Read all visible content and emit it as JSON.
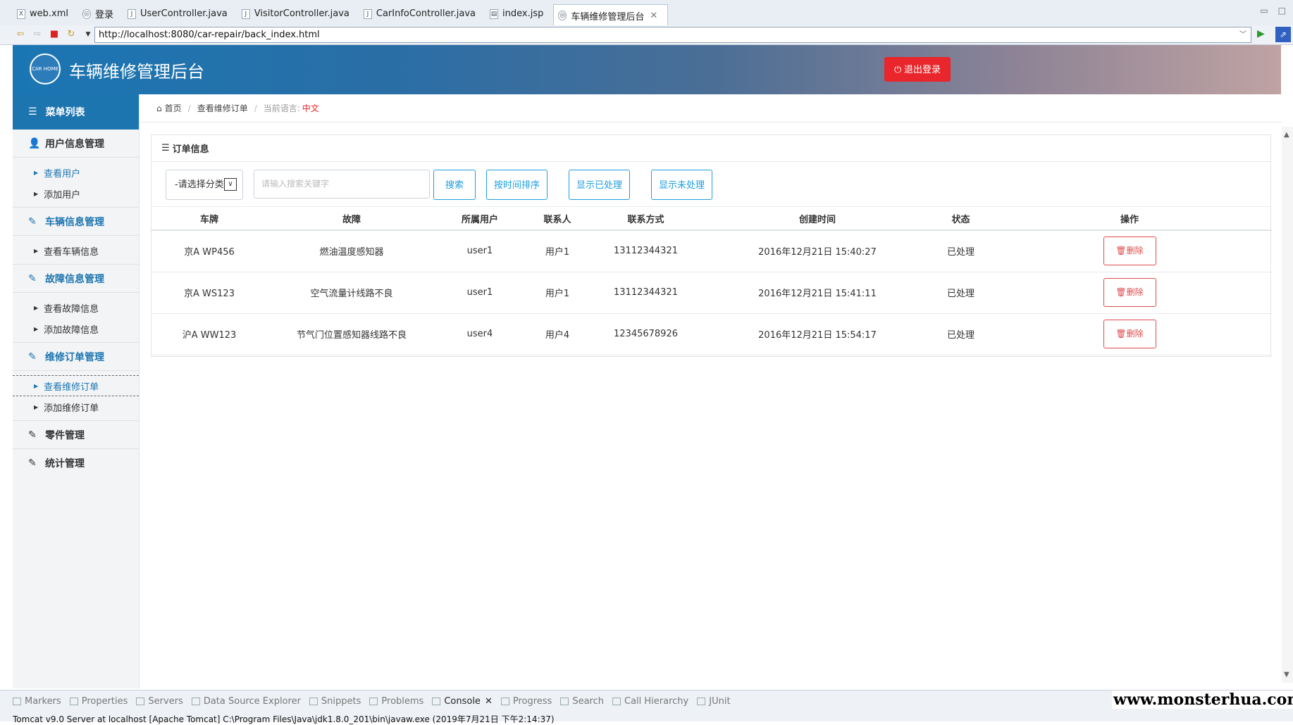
{
  "ide_tabs": [
    {
      "label": "web.xml",
      "icon": "xml-file-icon"
    },
    {
      "label": "登录",
      "icon": "globe-icon"
    },
    {
      "label": "UserController.java",
      "icon": "java-file-icon"
    },
    {
      "label": "VisitorController.java",
      "icon": "java-file-icon"
    },
    {
      "label": "CarInfoController.java",
      "icon": "java-file-icon"
    },
    {
      "label": "index.jsp",
      "icon": "jsp-file-icon"
    },
    {
      "label": "车辆维修管理后台",
      "icon": "globe-icon",
      "active": true
    }
  ],
  "browser": {
    "url": "http://localhost:8080/car-repair/back_index.html"
  },
  "header": {
    "title": "车辆维修管理后台",
    "logout_label": "⏻ 退出登录",
    "logo_text": "CAR HOME"
  },
  "sidebar": {
    "menu_title": "菜单列表",
    "sections": [
      {
        "label": "用户信息管理",
        "items": [
          "查看用户",
          "添加用户"
        ]
      },
      {
        "label": "车辆信息管理",
        "items": [
          "查看车辆信息"
        ]
      },
      {
        "label": "故障信息管理",
        "items": [
          "查看故障信息",
          "添加故障信息"
        ]
      },
      {
        "label": "维修订单管理",
        "items": [
          "查看维修订单",
          "添加维修订单"
        ]
      },
      {
        "label": "零件管理"
      },
      {
        "label": "统计管理"
      }
    ]
  },
  "breadcrumb": {
    "home": "首页",
    "current": "查看维修订单",
    "lang_label": "当前语言:",
    "lang_value": "中文"
  },
  "panel": {
    "title": "订单信息",
    "select_value": "-请选择分类",
    "search_placeholder": "请输入搜索关键字",
    "buttons": [
      "搜索",
      "按时间排序",
      "显示已处理",
      "显示未处理"
    ]
  },
  "table": {
    "headers": [
      "车牌",
      "故障",
      "所属用户",
      "联系人",
      "联系方式",
      "创建时间",
      "状态",
      "操作"
    ],
    "rows": [
      [
        "京A WP456",
        "燃油温度感知器",
        "user1",
        "用户1",
        "13112344321",
        "2016年12月21日 15:40:27",
        "已处理",
        "删除"
      ],
      [
        "京A WS123",
        "空气流量计线路不良",
        "user1",
        "用户1",
        "13112344321",
        "2016年12月21日 15:41:11",
        "已处理",
        "删除"
      ],
      [
        "沪A WW123",
        "节气门位置感知器线路不良",
        "user4",
        "用户4",
        "12345678926",
        "2016年12月21日 15:54:17",
        "已处理",
        "删除"
      ]
    ]
  },
  "bottom_views": [
    "Markers",
    "Properties",
    "Servers",
    "Data Source Explorer",
    "Snippets",
    "Problems",
    "Console",
    "Progress",
    "Search",
    "Call Hierarchy",
    "JUnit"
  ],
  "status_line": "Tomcat v9.0 Server at localhost [Apache Tomcat] C:\\Program Files\\Java\\jdk1.8.0_201\\bin\\javaw.exe (2019年7月21日 下午2:14:37)",
  "watermark": "www.monsterhua.com",
  "colors": {
    "brand_blue": "#1d75b0",
    "danger": "#e8262b",
    "ok_green": "#27b36b",
    "btn_blue": "#1d9ee0"
  }
}
